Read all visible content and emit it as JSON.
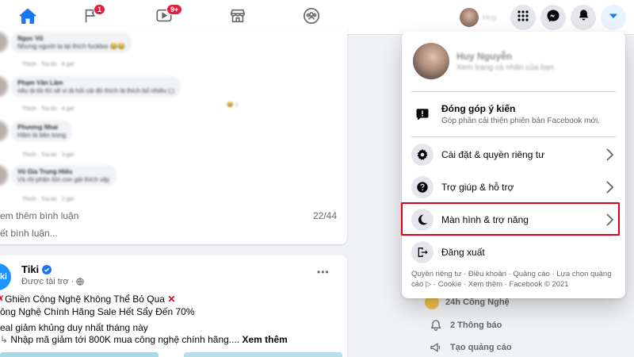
{
  "nav": {
    "tabs": [
      {
        "name": "home",
        "icon": "home-icon",
        "active": true,
        "badge": ""
      },
      {
        "name": "pages",
        "icon": "flag-icon",
        "active": false,
        "badge": "1"
      },
      {
        "name": "watch",
        "icon": "video-icon",
        "active": false,
        "badge": "9+"
      },
      {
        "name": "marketplace",
        "icon": "store-icon",
        "active": false,
        "badge": ""
      },
      {
        "name": "groups",
        "icon": "groups-icon",
        "active": false,
        "badge": ""
      }
    ],
    "profile_short_name": "Huy",
    "buttons": [
      "menu-grid-icon",
      "messenger-icon",
      "bell-icon",
      "caret-down-icon"
    ],
    "accent_color": "#1877f2",
    "badge_color": "#e41e3f"
  },
  "feed": {
    "comments": [
      {
        "name": "Ngọc Vũ",
        "text": "Nhưng người ta lại thích fuckboi 😂😂",
        "actions": "Thích · Trả lời · 6 giờ"
      },
      {
        "name": "Phạm Văn Lâm",
        "text": "nếu là tôi thì sẽ vì là hỏi cái đó thích là thích bố nhiều (:)",
        "actions": "Thích · Trả lời · 4 giờ"
      },
      {
        "name": "Phương Nhai",
        "text": "Hâm là bên trong",
        "actions": "Thích · Trả lời · 3 giờ"
      },
      {
        "name": "Vũ Gia Trung Hiếu",
        "text": "Và rồi phân tồn con gái thích vậy",
        "actions": "Thích · Trả lời · 2 giờ"
      }
    ],
    "reply_count": "1",
    "see_more_comments": "em thêm bình luận",
    "comment_count": "22/44",
    "write_comment": "ết bình luận...",
    "ad": {
      "page_name": "Tiki",
      "logo_text": "tiki",
      "sponsored": "Được tài trợ ·",
      "lines": [
        "Ghiền Công Nghệ Không Thể Bỏ Qua",
        "ông Nghệ Chính Hãng Sale Hết Sẩy Đến 70%",
        "eal giảm khủng duy nhất tháng này",
        "Nhập mã giảm tới 800K mua công nghệ chính hãng...."
      ],
      "see_more": "Xem thêm",
      "more_options": "•••"
    }
  },
  "right_column": {
    "partial_item": "24h Công Nghệ",
    "items": [
      {
        "icon": "bell-icon",
        "label": "2 Thông báo"
      },
      {
        "icon": "megaphone-icon",
        "label": "Tạo quảng cáo"
      }
    ]
  },
  "menu": {
    "profile": {
      "name": "Huy Nguyễn",
      "subtitle": "Xem trang cá nhân của bạn"
    },
    "feedback": {
      "title": "Đóng góp ý kiến",
      "description": "Góp phần cải thiện phiên bản Facebook mới."
    },
    "items": [
      {
        "label": "Cài đặt & quyền riêng tư",
        "icon": "gear-icon",
        "chevron": true
      },
      {
        "label": "Trợ giúp & hỗ trợ",
        "icon": "question-icon",
        "chevron": true
      },
      {
        "label": "Màn hình & trợ năng",
        "icon": "moon-icon",
        "chevron": true
      },
      {
        "label": "Đăng xuất",
        "icon": "logout-icon",
        "chevron": false
      }
    ],
    "footer": "Quyền riêng tư · Điều khoản · Quảng cáo · Lựa chọn quảng cáo ▷ · Cookie · Xem thêm · Facebook © 2021",
    "highlight_color": "#e0001a"
  }
}
